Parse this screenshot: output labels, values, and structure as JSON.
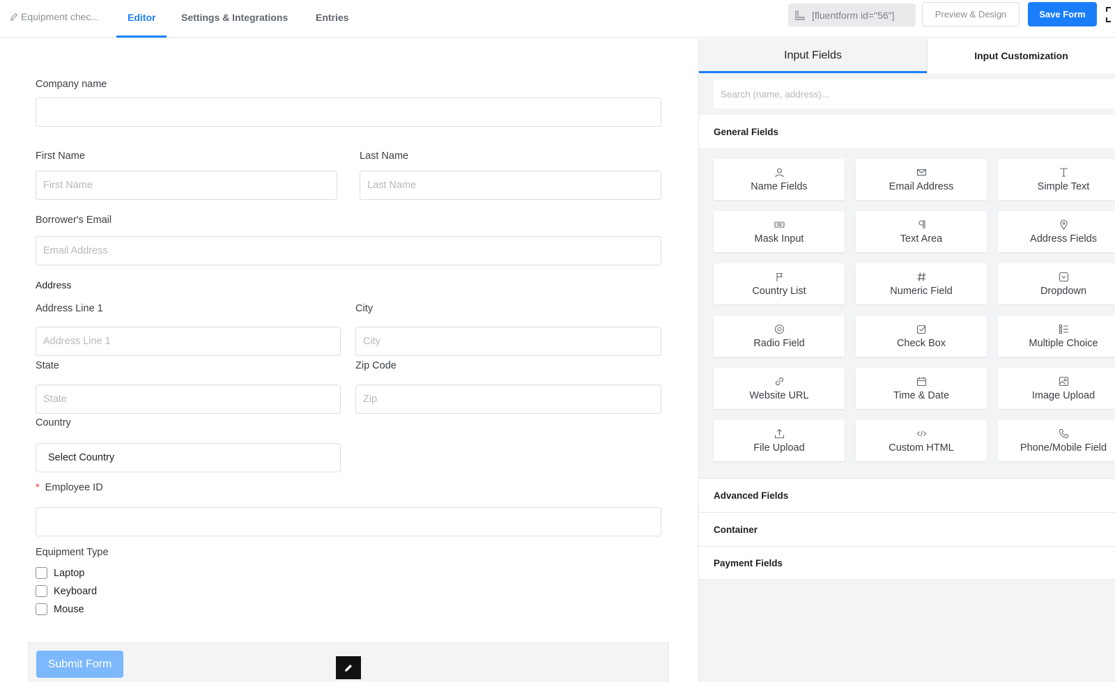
{
  "header": {
    "breadcrumb": "Equipment chec...",
    "tabs": [
      "Editor",
      "Settings & Integrations",
      "Entries"
    ],
    "shortcode": "[fluentform id=\"56\"]",
    "preview_label": "Preview & Design",
    "save_label": "Save Form"
  },
  "form": {
    "company": {
      "label": "Company name",
      "placeholder": ""
    },
    "first_name": {
      "label": "First Name",
      "placeholder": "First Name"
    },
    "last_name": {
      "label": "Last Name",
      "placeholder": "Last Name"
    },
    "email": {
      "label": "Borrower's Email",
      "placeholder": "Email Address"
    },
    "address": {
      "heading": "Address",
      "line1": {
        "label": "Address Line 1",
        "placeholder": "Address Line 1"
      },
      "city": {
        "label": "City",
        "placeholder": "City"
      },
      "state": {
        "label": "State",
        "placeholder": "State"
      },
      "zip": {
        "label": "Zip Code",
        "placeholder": "Zip"
      },
      "country": {
        "label": "Country",
        "value": "Select Country"
      }
    },
    "employee_id": {
      "required_mark": "*",
      "label": "Employee ID",
      "placeholder": ""
    },
    "equipment": {
      "label": "Equipment Type",
      "options": [
        "Laptop",
        "Keyboard",
        "Mouse"
      ]
    },
    "submit_label": "Submit Form"
  },
  "sidebar": {
    "tabs": [
      "Input Fields",
      "Input Customization"
    ],
    "search_placeholder": "Search (name, address)...",
    "general_heading": "General Fields",
    "fields": [
      {
        "label": "Name Fields",
        "icon": "user-icon"
      },
      {
        "label": "Email Address",
        "icon": "envelope-icon"
      },
      {
        "label": "Simple Text",
        "icon": "text-cursor-icon"
      },
      {
        "label": "Mask Input",
        "icon": "keyboard-icon"
      },
      {
        "label": "Text Area",
        "icon": "paragraph-icon"
      },
      {
        "label": "Address Fields",
        "icon": "map-pin-icon"
      },
      {
        "label": "Country List",
        "icon": "flag-icon"
      },
      {
        "label": "Numeric Field",
        "icon": "hash-icon"
      },
      {
        "label": "Dropdown",
        "icon": "dropdown-icon"
      },
      {
        "label": "Radio Field",
        "icon": "radio-icon"
      },
      {
        "label": "Check Box",
        "icon": "checkbox-icon"
      },
      {
        "label": "Multiple Choice",
        "icon": "list-icon"
      },
      {
        "label": "Website URL",
        "icon": "link-icon"
      },
      {
        "label": "Time & Date",
        "icon": "calendar-icon"
      },
      {
        "label": "Image Upload",
        "icon": "image-icon"
      },
      {
        "label": "File Upload",
        "icon": "upload-icon"
      },
      {
        "label": "Custom HTML",
        "icon": "code-icon"
      },
      {
        "label": "Phone/Mobile Field",
        "icon": "phone-icon"
      }
    ],
    "sections": [
      "Advanced Fields",
      "Container",
      "Payment Fields"
    ]
  },
  "colors": {
    "accent": "#1a7efb",
    "submit": "#7cb8fb",
    "required": "#ee3a3a"
  }
}
